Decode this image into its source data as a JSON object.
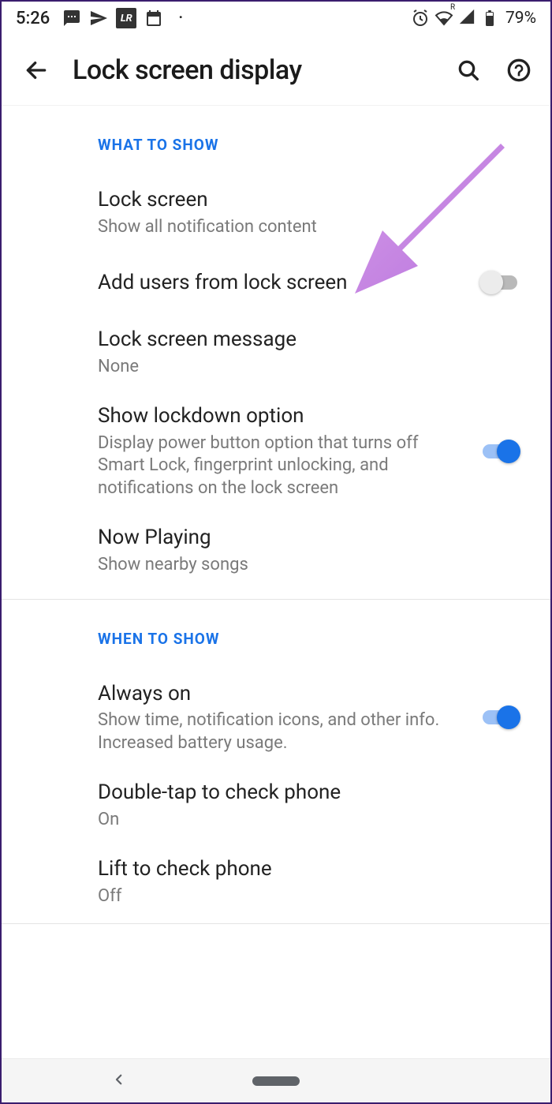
{
  "status": {
    "time": "5:26",
    "battery": "79%"
  },
  "header": {
    "title": "Lock screen display"
  },
  "sections": {
    "what_to_show": {
      "header": "WHAT TO SHOW",
      "lock_screen": {
        "title": "Lock screen",
        "sub": "Show all notification content"
      },
      "add_users": {
        "title": "Add users from lock screen"
      },
      "lock_msg": {
        "title": "Lock screen message",
        "sub": "None"
      },
      "lockdown": {
        "title": "Show lockdown option",
        "sub": "Display power button option that turns off Smart Lock, fingerprint unlocking, and notifications on the lock screen"
      },
      "now_playing": {
        "title": "Now Playing",
        "sub": "Show nearby songs"
      }
    },
    "when_to_show": {
      "header": "WHEN TO SHOW",
      "always_on": {
        "title": "Always on",
        "sub": "Show time, notification icons, and other info. Increased battery usage."
      },
      "double_tap": {
        "title": "Double-tap to check phone",
        "sub": "On"
      },
      "lift": {
        "title": "Lift to check phone",
        "sub": "Off"
      }
    }
  },
  "toggles": {
    "add_users": false,
    "lockdown": true,
    "always_on": true
  }
}
